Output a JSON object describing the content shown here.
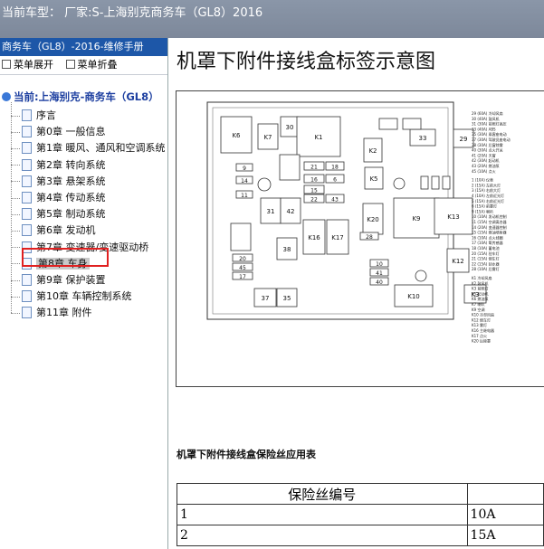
{
  "topbar": {
    "title": "当前车型：  厂家:S-上海别克商务车（GL8）2016"
  },
  "left": {
    "header": "商务车（GL8）-2016-维修手册",
    "expand_label": "菜单展开",
    "collapse_label": "菜单折叠",
    "root_label": "当前:上海别克-商务车（GL8）",
    "items": [
      "序言",
      "第0章 一般信息",
      "第1章 暖风、通风和空调系统",
      "第2章 转向系统",
      "第3章 悬架系统",
      "第4章 传动系统",
      "第5章 制动系统",
      "第6章 发动机",
      "第7章 变速器/变速驱动桥",
      "第8章 车身",
      "第9章 保护装置",
      "第10章 车辆控制系统",
      "第11章 附件"
    ],
    "selected_index": 9
  },
  "main": {
    "title": "机罩下附件接线盒标签示意图",
    "subtitle": "机罩下附件接线盒保险丝应用表",
    "diagram": {
      "fuse_labels": [
        "K6",
        "K7",
        "30",
        "K1",
        "K2",
        "33",
        "29",
        "9",
        "14",
        "11",
        "21",
        "16",
        "15",
        "22",
        "18",
        "6",
        "5",
        "43",
        "K5",
        "31",
        "42",
        "K20",
        "K9",
        "K13",
        "K16",
        "K17",
        "28",
        "20",
        "45",
        "17",
        "38",
        "10",
        "41",
        "40",
        "K12",
        "37",
        "35",
        "K10",
        "K3"
      ],
      "legend_rows": [
        [
          "29",
          "(60A)",
          "冷却风扇"
        ],
        [
          "30",
          "(40A)",
          "鼓风机"
        ],
        [
          "31",
          "(30A)",
          "前照灯高压"
        ],
        [
          "33",
          "(40A)",
          "ABS"
        ],
        [
          "35",
          "(30A)",
          "乘客座电动"
        ],
        [
          "37",
          "(30A)",
          "驾驶员座电动"
        ],
        [
          "38",
          "(30A)",
          "后窗除雾"
        ],
        [
          "40",
          "(30A)",
          "点火开关"
        ],
        [
          "41",
          "(20A)",
          "天窗"
        ],
        [
          "42",
          "(30A)",
          "起动机"
        ],
        [
          "43",
          "(20A)",
          "燃油泵"
        ],
        [
          "45",
          "(10A)",
          "点火"
        ],
        [
          "1",
          "(10A)",
          "仪表"
        ],
        [
          "2",
          "(15A)",
          "左前大灯"
        ],
        [
          "3",
          "(15A)",
          "右前大灯"
        ],
        [
          "4",
          "(10A)",
          "左前近光灯"
        ],
        [
          "5",
          "(15A)",
          "右前近光灯"
        ],
        [
          "6",
          "(15A)",
          "前雾灯"
        ],
        [
          "9",
          "(15A)",
          "喇叭"
        ],
        [
          "10",
          "(10A)",
          "发动机控制"
        ],
        [
          "11",
          "(15A)",
          "空调离合器"
        ],
        [
          "14",
          "(20A)",
          "变速器控制"
        ],
        [
          "15",
          "(15A)",
          "燃油喷射器"
        ],
        [
          "16",
          "(10A)",
          "点火线圈"
        ],
        [
          "17",
          "(10A)",
          "氧传感器"
        ],
        [
          "18",
          "(10A)",
          "蓄电池"
        ],
        [
          "20",
          "(15A)",
          "驻车灯"
        ],
        [
          "21",
          "(15A)",
          "倒车灯"
        ],
        [
          "22",
          "(15A)",
          "刮水器"
        ],
        [
          "28",
          "(10A)",
          "后雾灯"
        ],
        [
          "K1",
          "",
          "冷却风扇"
        ],
        [
          "K2",
          "",
          "鼓风机"
        ],
        [
          "K3",
          "",
          "前照灯"
        ],
        [
          "K5",
          "",
          "起动机"
        ],
        [
          "K6",
          "",
          "燃油泵"
        ],
        [
          "K7",
          "",
          "喇叭"
        ],
        [
          "K9",
          "",
          "空调"
        ],
        [
          "K10",
          "",
          "冷却风扇"
        ],
        [
          "K12",
          "",
          "倒车灯"
        ],
        [
          "K13",
          "",
          "雾灯"
        ],
        [
          "K16",
          "",
          "主继电器"
        ],
        [
          "K17",
          "",
          "点火"
        ],
        [
          "K20",
          "",
          "后除雾"
        ]
      ]
    },
    "table": {
      "header": [
        "保险丝编号",
        ""
      ],
      "rows": [
        [
          "1",
          "10A"
        ],
        [
          "2",
          "15A"
        ]
      ]
    }
  }
}
